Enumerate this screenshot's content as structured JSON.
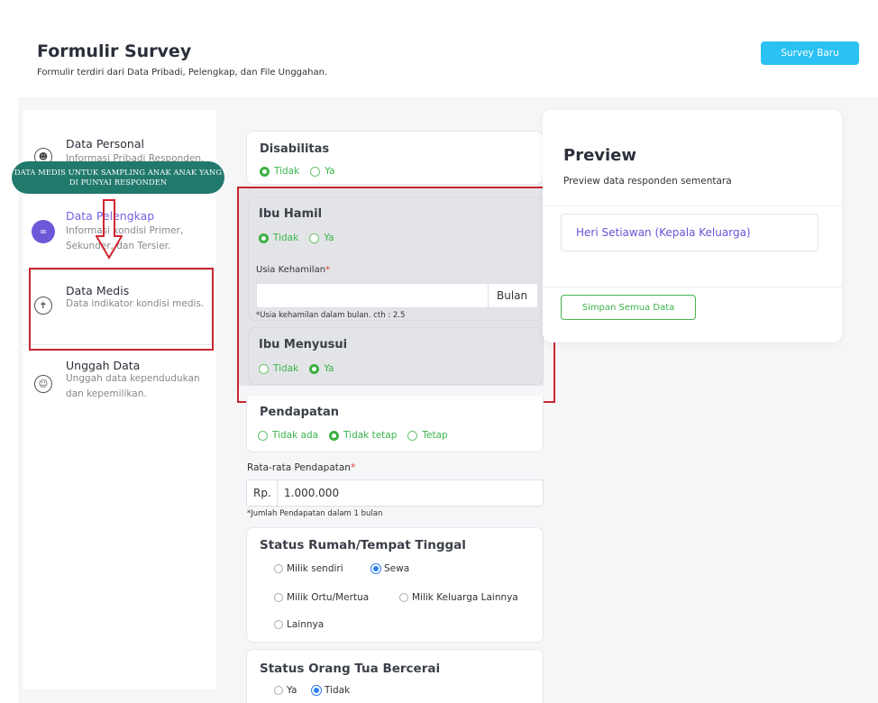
{
  "header": {
    "title": "Formulir Survey",
    "subtitle": "Formulir terdiri dari Data Pribadi, Pelengkap, dan File Unggahan.",
    "new_button": "Survey Baru"
  },
  "sidebar": {
    "items": [
      {
        "title": "Data Personal",
        "desc": "Informasi Pribadi Responden.",
        "icon": "person-icon"
      },
      {
        "title": "Data Pelengkap",
        "desc": "Informasi kondisi Primer, Sekunder, dan Tersier.",
        "icon": "link-icon"
      },
      {
        "title": "Data Medis",
        "desc": "Data indikator kondisi medis.",
        "icon": "medical-icon"
      },
      {
        "title": "Unggah Data",
        "desc": "Unggah data kependudukan dan kepemilikan.",
        "icon": "users-icon"
      }
    ]
  },
  "annotation": {
    "callout": "DATA MEDIS UNTUK SAMPLING ANAK ANAK YANG DI PUNYAI RESPONDEN"
  },
  "form": {
    "disabilitas": {
      "title": "Disabilitas",
      "options": [
        "Tidak",
        "Ya"
      ],
      "selected": "Tidak"
    },
    "ibu_hamil": {
      "title": "Ibu Hamil",
      "options": [
        "Tidak",
        "Ya"
      ],
      "selected": "Tidak"
    },
    "usia_kehamilan": {
      "label": "Usia Kehamilan",
      "required_mark": "*",
      "value": "",
      "addon": "Bulan",
      "hint": "*Usia kehamilan dalam bulan. cth : 2.5"
    },
    "ibu_menyusui": {
      "title": "Ibu Menyusui",
      "options": [
        "Tidak",
        "Ya"
      ],
      "selected": "Ya"
    },
    "pendapatan": {
      "title": "Pendapatan",
      "options": [
        "Tidak ada",
        "Tidak tetap",
        "Tetap"
      ],
      "selected": "Tidak tetap"
    },
    "rata_pendapatan": {
      "label": "Rata-rata Pendapatan",
      "required_mark": "*",
      "prefix": "Rp.",
      "value": "1.000.000",
      "hint": "*Jumlah Pendapatan dalam 1 bulan"
    },
    "status_rumah": {
      "title": "Status Rumah/Tempat Tinggal",
      "options": [
        "Milik sendiri",
        "Sewa",
        "Milik Ortu/Mertua",
        "Milik Keluarga Lainnya",
        "Lainnya"
      ],
      "selected": "Sewa"
    },
    "status_cerai": {
      "title": "Status Orang Tua Bercerai",
      "options": [
        "Ya",
        "Tidak"
      ],
      "selected": "Tidak"
    }
  },
  "preview": {
    "title": "Preview",
    "subtitle": "Preview data responden sementara",
    "respondent": "Heri Setiawan (Kepala Keluarga)",
    "save_button": "Simpan Semua Data"
  },
  "colors": {
    "accent_blue": "#2bc1f2",
    "green": "#3cb043",
    "purple": "#6b59d9",
    "annotation_red": "#c8262f",
    "callout_teal": "#21796c"
  }
}
